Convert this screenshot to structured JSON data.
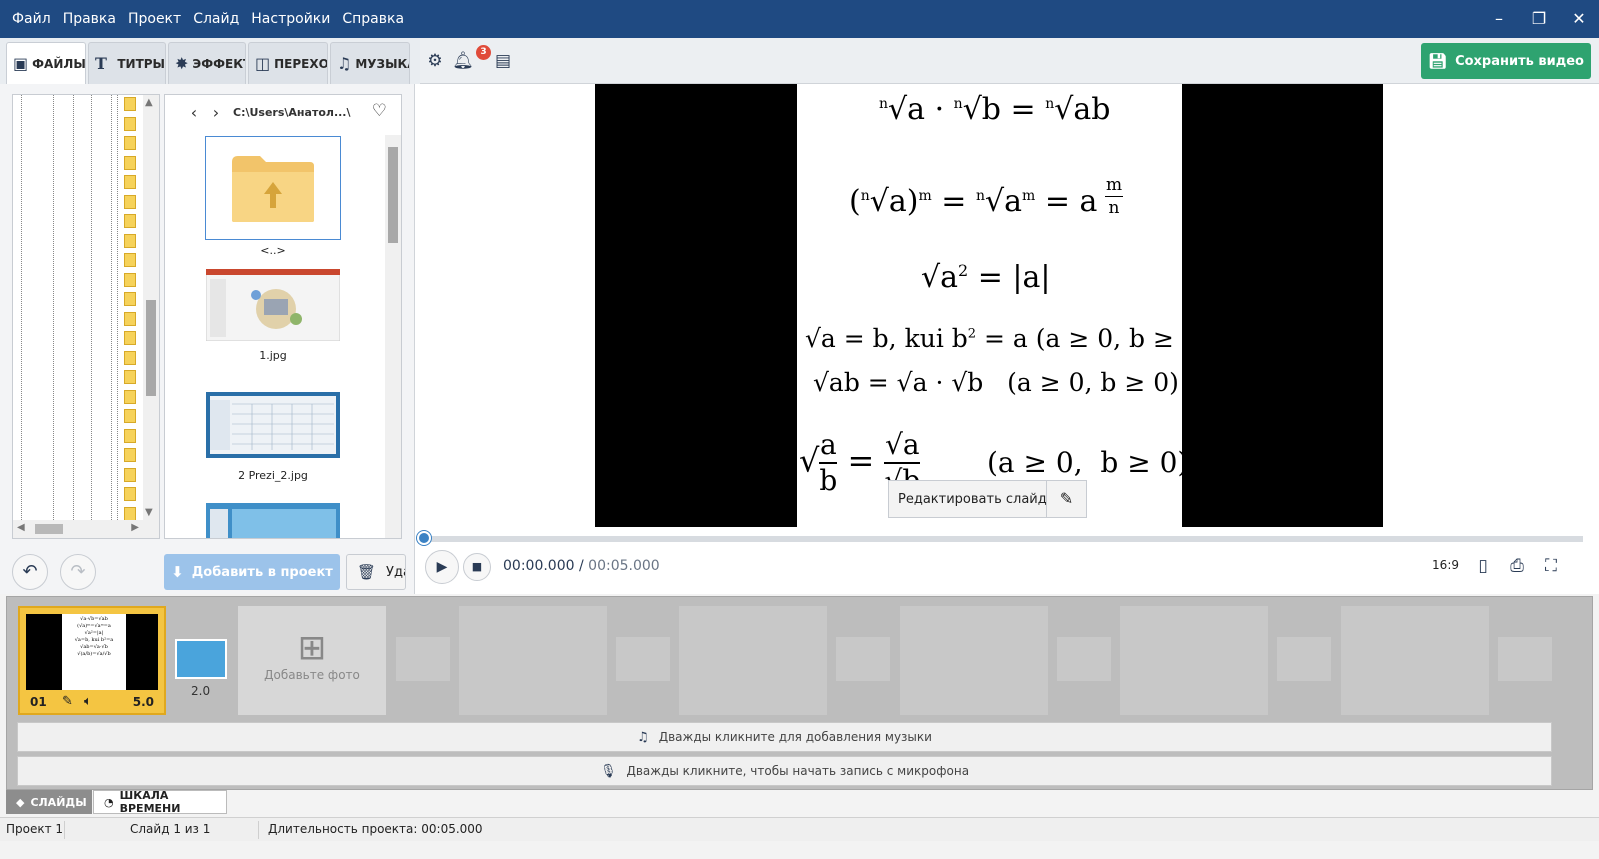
{
  "menu": [
    "Файл",
    "Правка",
    "Проект",
    "Слайд",
    "Настройки",
    "Справка"
  ],
  "window": {
    "minimize": "–",
    "restore": "❐",
    "close": "✕"
  },
  "tabs": [
    {
      "label": "ФАЙЛЫ",
      "icon": "add-photo-icon"
    },
    {
      "label": "ТИТРЫ",
      "icon": "text-icon"
    },
    {
      "label": "ЭФФЕКТЫ",
      "icon": "star-icon"
    },
    {
      "label": "ПЕРЕХОДЫ",
      "icon": "transition-icon"
    },
    {
      "label": "МУЗЫКА",
      "icon": "music-icon"
    }
  ],
  "toolbar": {
    "notifications_count": "3",
    "save_label": "Сохранить видео"
  },
  "filebrowser": {
    "path": "C:\\Users\\Анатол...\\",
    "items": [
      {
        "label": "<..>"
      },
      {
        "label": "1.jpg"
      },
      {
        "label": "2 Prezi_2.jpg"
      },
      {
        "label": ""
      }
    ]
  },
  "actions": {
    "add_label": "Добавить в проект",
    "delete_label": "Удалить"
  },
  "preview": {
    "edit_label": "Редактировать слайд",
    "time_current": "00:00.000",
    "time_separator": " / ",
    "time_total": "00:05.000",
    "ratio": "16:9",
    "progress": 0
  },
  "timeline": {
    "clip": {
      "number": "01",
      "duration": "5.0"
    },
    "transition_duration": "2.0",
    "add_photo_label": "Добавьте фото",
    "music_track_label": "Дважды кликните для добавления музыки",
    "mic_track_label": "Дважды кликните, чтобы начать запись с микрофона"
  },
  "bottom_tabs": {
    "slides": "СЛАЙДЫ",
    "timeline": "ШКАЛА ВРЕМЕНИ"
  },
  "status": {
    "project": "Проект 1",
    "slide": "Слайд 1 из 1",
    "duration": "Длительность проекта: 00:05.000"
  },
  "colors": {
    "titlebar": "#1f4a82",
    "save": "#2ea370",
    "accent": "#3b82c4",
    "clip": "#f4c542"
  }
}
